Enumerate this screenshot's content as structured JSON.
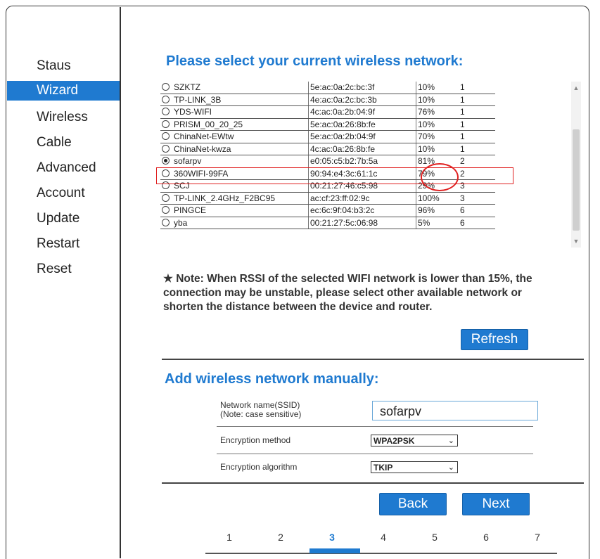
{
  "sidebar": {
    "items": [
      {
        "label": "Staus"
      },
      {
        "label": "Wizard"
      },
      {
        "label": "Wireless"
      },
      {
        "label": "Cable"
      },
      {
        "label": "Advanced"
      },
      {
        "label": "Account"
      },
      {
        "label": "Update"
      },
      {
        "label": "Restart"
      },
      {
        "label": "Reset"
      }
    ],
    "active": "Wizard"
  },
  "select_section": {
    "title": "Please select your current wireless network:",
    "networks": [
      {
        "ssid": "SZKTZ",
        "mac": "5e:ac:0a:2c:bc:3f",
        "rssi": "10%",
        "channel": "1",
        "selected": false
      },
      {
        "ssid": "TP-LINK_3B",
        "mac": "4e:ac:0a:2c:bc:3b",
        "rssi": "10%",
        "channel": "1",
        "selected": false
      },
      {
        "ssid": "YDS-WIFI",
        "mac": "4c:ac:0a:2b:04:9f",
        "rssi": "76%",
        "channel": "1",
        "selected": false
      },
      {
        "ssid": "PRISM_00_20_25",
        "mac": "5e:ac:0a:26:8b:fe",
        "rssi": "10%",
        "channel": "1",
        "selected": false
      },
      {
        "ssid": "ChinaNet-EWtw",
        "mac": "5e:ac:0a:2b:04:9f",
        "rssi": "70%",
        "channel": "1",
        "selected": false
      },
      {
        "ssid": "ChinaNet-kwza",
        "mac": "4c:ac:0a:26:8b:fe",
        "rssi": "10%",
        "channel": "1",
        "selected": false
      },
      {
        "ssid": "sofarpv",
        "mac": "e0:05:c5:b2:7b:5a",
        "rssi": "81%",
        "channel": "2",
        "selected": true
      },
      {
        "ssid": "360WIFI-99FA",
        "mac": "90:94:e4:3c:61:1c",
        "rssi": "79%",
        "channel": "2",
        "selected": false
      },
      {
        "ssid": "SCJ",
        "mac": "00:21:27:46:c5:98",
        "rssi": "29%",
        "channel": "3",
        "selected": false
      },
      {
        "ssid": "TP-LINK_2.4GHz_F2BC95",
        "mac": "ac:cf:23:ff:02:9c",
        "rssi": "100%",
        "channel": "3",
        "selected": false
      },
      {
        "ssid": "PINGCE",
        "mac": "ec:6c:9f:04:b3:2c",
        "rssi": "96%",
        "channel": "6",
        "selected": false
      },
      {
        "ssid": "yba",
        "mac": "00:21:27:5c:06:98",
        "rssi": "5%",
        "channel": "6",
        "selected": false
      }
    ],
    "note": "★ Note: When RSSI of the selected WIFI network is lower than 15%, the connection may be unstable, please select other available network or shorten the distance between the device and router.",
    "refresh_label": "Refresh"
  },
  "manual_section": {
    "title": "Add wireless network manually:",
    "ssid_label_line1": "Network name(SSID)",
    "ssid_label_line2": "(Note: case sensitive)",
    "ssid_value": "sofarpv",
    "encryption_method_label": "Encryption method",
    "encryption_method_value": "WPA2PSK",
    "encryption_algorithm_label": "Encryption algorithm",
    "encryption_algorithm_value": "TKIP"
  },
  "buttons": {
    "back": "Back",
    "next": "Next"
  },
  "steps": {
    "items": [
      "1",
      "2",
      "3",
      "4",
      "5",
      "6",
      "7"
    ],
    "current": 3
  },
  "colors": {
    "accent": "#1f7ad0",
    "highlight": "#e02020"
  }
}
